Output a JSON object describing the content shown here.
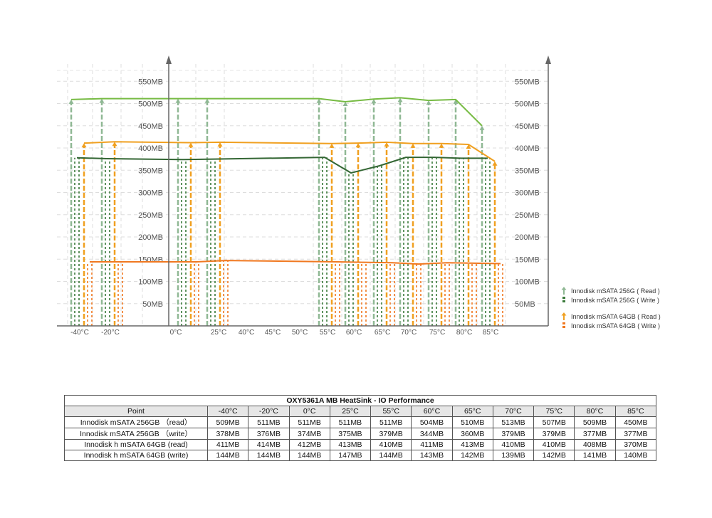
{
  "chart_data": {
    "type": "line",
    "temperatures": [
      "-40°C",
      "-20°C",
      "0°C",
      "25°C",
      "55°C",
      "60°C",
      "65°C",
      "70°C",
      "75°C",
      "80°C",
      "85°C"
    ],
    "x_axis_ticks": [
      "-40°C",
      "-20°C",
      "0°C",
      "25°C",
      "40°C",
      "45°C",
      "50°C",
      "55°C",
      "60°C",
      "65°C",
      "70°C",
      "75°C",
      "80°C",
      "85°C"
    ],
    "y_axis_ticks": [
      "50MB",
      "100MB",
      "150MB",
      "200MB",
      "250MB",
      "300MB",
      "350MB",
      "400MB",
      "450MB",
      "500MB",
      "550MB"
    ],
    "ylim": [
      0,
      600
    ],
    "grid": true,
    "series": [
      {
        "name": "Innodisk mSATA 256G ( Read )",
        "color": "#77bb44",
        "marker": "#8fb894",
        "style": "read",
        "values": [
          509,
          511,
          511,
          511,
          511,
          504,
          510,
          513,
          507,
          509,
          450
        ]
      },
      {
        "name": "Innodisk mSATA 256G ( Write )",
        "color": "#336633",
        "marker": "#3a7a3a",
        "style": "write",
        "values": [
          378,
          376,
          374,
          375,
          379,
          344,
          360,
          379,
          379,
          377,
          377
        ]
      },
      {
        "name": "Innodisk mSATA 64GB ( Read )",
        "color": "#f0a020",
        "marker": "#f0a020",
        "style": "read",
        "values": [
          411,
          414,
          412,
          413,
          410,
          411,
          413,
          410,
          410,
          408,
          370
        ]
      },
      {
        "name": "Innodisk mSATA 64GB ( Write )",
        "color": "#f07820",
        "marker": "#f07820",
        "style": "write",
        "values": [
          144,
          144,
          144,
          147,
          144,
          143,
          142,
          139,
          142,
          141,
          140
        ]
      }
    ]
  },
  "legend": {
    "items": [
      {
        "label": "Innodisk mSATA 256G ( Read )",
        "color": "#8fb894",
        "style": "read"
      },
      {
        "label": "Innodisk mSATA 256G ( Write )",
        "color": "#3a7a3a",
        "style": "write"
      },
      {
        "label": "Innodisk mSATA 64GB ( Read )",
        "color": "#f0a020",
        "style": "read"
      },
      {
        "label": "Innodisk mSATA 64GB ( Write )",
        "color": "#f07820",
        "style": "write"
      }
    ]
  },
  "table": {
    "title": "OXY5361A MB HeatSink - IO Performance",
    "point_header": "Point",
    "columns": [
      "-40°C",
      "-20°C",
      "0°C",
      "25°C",
      "55°C",
      "60°C",
      "65°C",
      "70°C",
      "75°C",
      "80°C",
      "85°C"
    ],
    "rows": [
      {
        "label": "Innodisk mSATA 256GB （read）",
        "cells": [
          "509MB",
          "511MB",
          "511MB",
          "511MB",
          "511MB",
          "504MB",
          "510MB",
          "513MB",
          "507MB",
          "509MB",
          "450MB"
        ]
      },
      {
        "label": "Innodisk mSATA 256GB （write）",
        "cells": [
          "378MB",
          "376MB",
          "374MB",
          "375MB",
          "379MB",
          "344MB",
          "360MB",
          "379MB",
          "379MB",
          "377MB",
          "377MB"
        ]
      },
      {
        "label": "Innodisk h mSATA 64GB (read)",
        "cells": [
          "411MB",
          "414MB",
          "412MB",
          "413MB",
          "410MB",
          "411MB",
          "413MB",
          "410MB",
          "410MB",
          "408MB",
          "370MB"
        ]
      },
      {
        "label": "Innodisk h mSATA 64GB (write)",
        "cells": [
          "144MB",
          "144MB",
          "144MB",
          "147MB",
          "144MB",
          "143MB",
          "142MB",
          "139MB",
          "142MB",
          "141MB",
          "140MB"
        ]
      }
    ]
  }
}
